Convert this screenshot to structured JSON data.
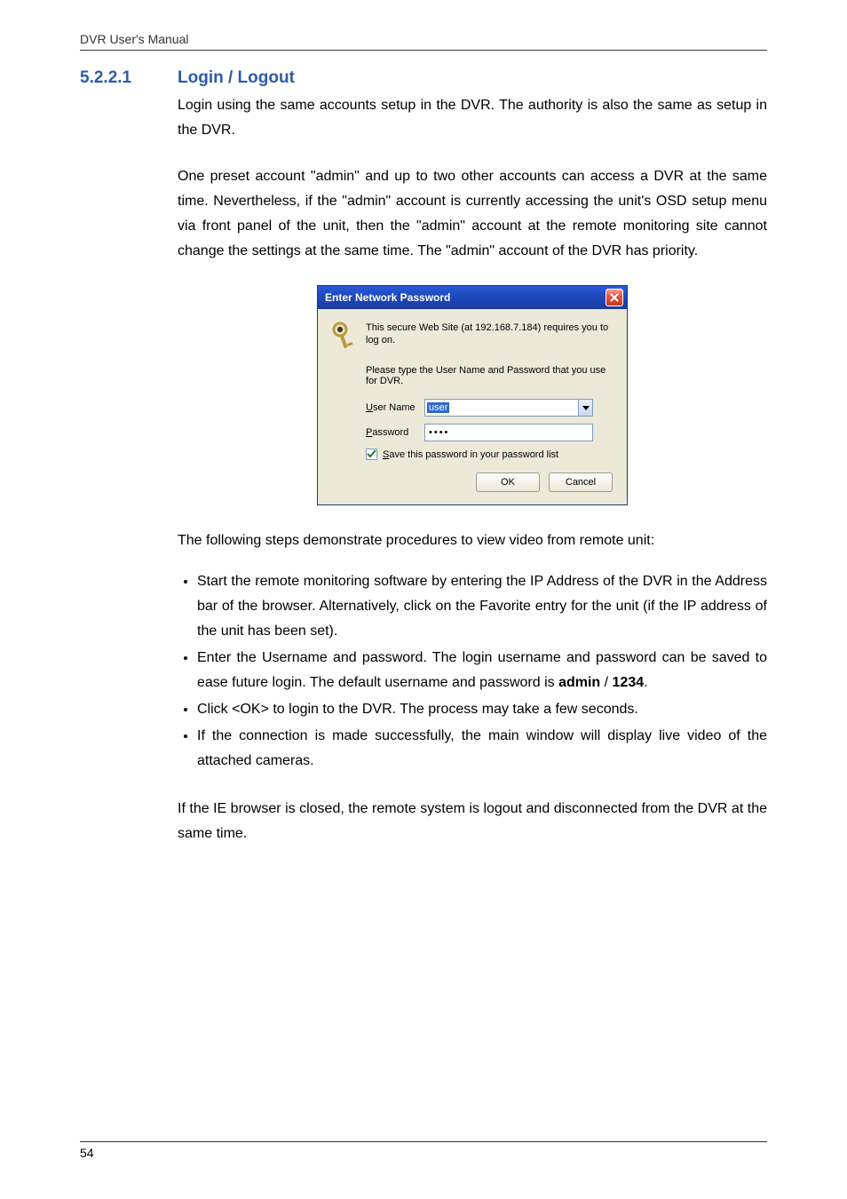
{
  "header": {
    "running": "DVR User's Manual"
  },
  "section": {
    "number": "5.2.2.1",
    "title": "Login / Logout"
  },
  "paras": {
    "p1": "Login using the same accounts setup in the DVR. The authority is also the same as setup in the DVR.",
    "p2": "One preset account \"admin\" and up to two other accounts can access a DVR at the same time. Nevertheless, if the \"admin\" account is currently accessing the unit's OSD setup menu via front panel of the unit, then the \"admin\" account at the remote monitoring site cannot change the settings at the same time. The \"admin\" account of the DVR has priority.",
    "p3": "The following steps demonstrate procedures to view video from remote unit:",
    "p4": "If the IE browser is closed, the remote system is logout and disconnected from the DVR at the same time."
  },
  "dialog": {
    "title": "Enter Network Password",
    "line1": "This secure Web Site (at 192.168.7.184) requires you to log on.",
    "line2": "Please type the User Name and Password that you use for DVR.",
    "username_label_pre": "U",
    "username_label_rest": "ser Name",
    "username_value": "user",
    "password_label_pre": "P",
    "password_label_rest": "assword",
    "password_value": "••••",
    "save_pre": "S",
    "save_rest": "ave this password in your password list",
    "save_checked": true,
    "ok": "OK",
    "cancel": "Cancel"
  },
  "steps": {
    "s1": "Start the remote monitoring software by entering the IP Address of the DVR in the Address bar of the browser. Alternatively, click on the Favorite entry for the unit (if the IP address of the unit has been set).",
    "s2a": "Enter the Username and password. The login username and password can be saved to ease future login. The default username and password is ",
    "s2b_admin": "admin",
    "s2b_sep": " / ",
    "s2b_pw": "1234",
    "s2b_dot": ".",
    "s3": "Click <OK> to login to the DVR. The process may take a few seconds.",
    "s4": "If the connection is made successfully, the main window will display live video of the attached cameras."
  },
  "footer": {
    "page": "54"
  }
}
